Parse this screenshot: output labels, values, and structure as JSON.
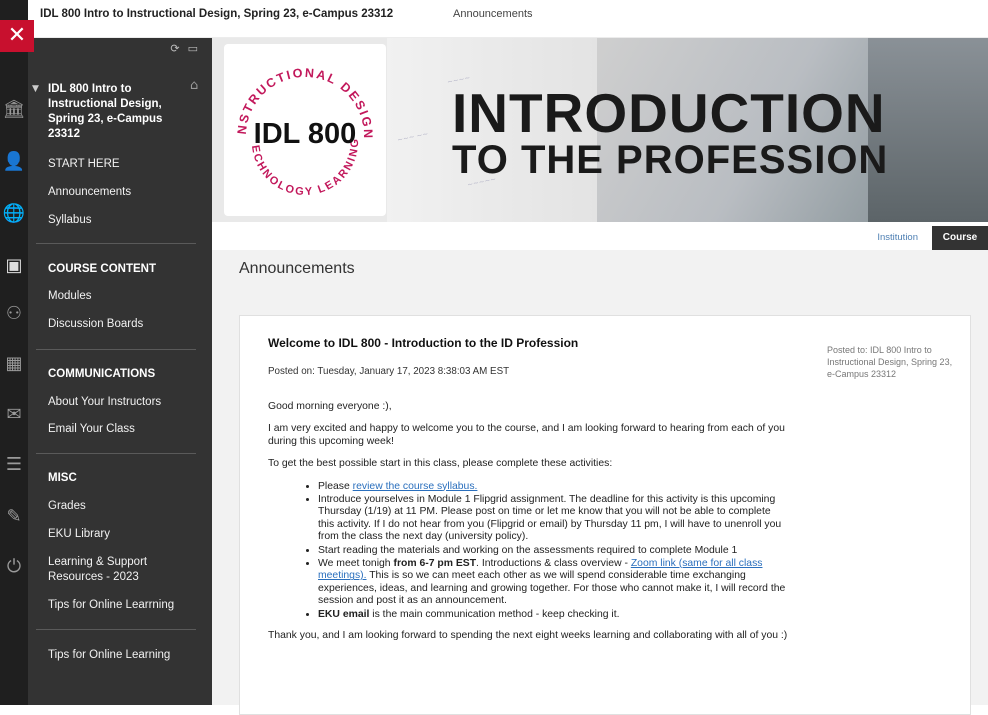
{
  "topbar": {
    "course": "IDL 800 Intro to Instructional Design, Spring 23, e-Campus 23312",
    "page": "Announcements"
  },
  "rail": {
    "close": "✕",
    "icons": [
      "institution-icon",
      "profile-icon",
      "globe-icon",
      "courses-icon",
      "groups-icon",
      "calendar-icon",
      "messages-icon",
      "grades-icon",
      "tools-icon",
      "sign-out-icon"
    ]
  },
  "sidebar": {
    "course_title": "IDL 800 Intro to Instructional Design, Spring 23, e-Campus 23312",
    "top_items": [
      "START HERE",
      "Announcements",
      "Syllabus"
    ],
    "sections": [
      {
        "title": "COURSE CONTENT",
        "items": [
          "Modules",
          "Discussion Boards"
        ]
      },
      {
        "title": "COMMUNICATIONS",
        "items": [
          "About Your Instructors",
          "Email Your Class"
        ]
      },
      {
        "title": "MISC",
        "items": [
          "Grades",
          "EKU Library",
          "Learning & Support Resources - 2023",
          "Tips for Online Learrning"
        ]
      }
    ],
    "bottom_item": "Tips for Online Learning"
  },
  "banner": {
    "logo_code": "IDL 800",
    "logo_ring_top": "INSTRUCTIONAL DESIGN",
    "logo_ring_bottom": "TECHNOLOGY LEARNING",
    "title_line1": "INTRODUCTION",
    "title_line2": "TO THE PROFESSION"
  },
  "tabs": {
    "institution": "Institution",
    "course": "Course"
  },
  "main": {
    "title": "Announcements",
    "announcement": {
      "title": "Welcome to IDL 800 - Introduction to the ID Profession",
      "posted_on": "Posted on: Tuesday, January 17, 2023 8:38:03 AM EST",
      "posted_to": "Posted to: IDL 800 Intro to Instructional Design, Spring 23, e-Campus 23312",
      "greeting": "Good morning everyone :),",
      "para1": "I am very excited and happy to welcome you to the course, and I am looking forward to hearing from each of you during this upcoming week!",
      "para2": "To get the best possible start in this class, please complete these activities:",
      "b1_pre": "Please ",
      "b1_link": "review the course syllabus.",
      "b2": "Introduce yourselves in Module 1 Flipgrid assignment. The deadline for this activity is this upcoming Thursday (1/19) at 11 PM.  Please post on time or let me know that you will not be able to complete this activity. If I do not hear from you (Flipgrid or email) by Thursday 11 pm, I will have to unenroll you from the class the next day (university policy).",
      "b3": "Start reading the materials and working on the assessments required to complete Module 1",
      "b4_pre": "We meet tonigh ",
      "b4_bold": "from 6-7 pm EST",
      "b4_mid": ". Introductions & class overview -  ",
      "b4_link": "Zoom link (same for all class meetings).",
      "b4_post": " This is so we can meet each other as we will spend considerable time exchanging experiences, ideas, and learning and growing together. For those who cannot make it, I will record the session and post it as an announcement.",
      "b5_bold": "EKU email",
      "b5_post": " is the main communication method - keep checking it.",
      "closing": "Thank you, and I am looking forward to spending the next eight weeks learning and collaborating with all of you :)"
    }
  },
  "colors": {
    "accent": "#c8102e",
    "sidebar": "#333333",
    "rail": "#1f1f1f",
    "link": "#2a6fbd",
    "logo_ring": "#c2185b"
  }
}
